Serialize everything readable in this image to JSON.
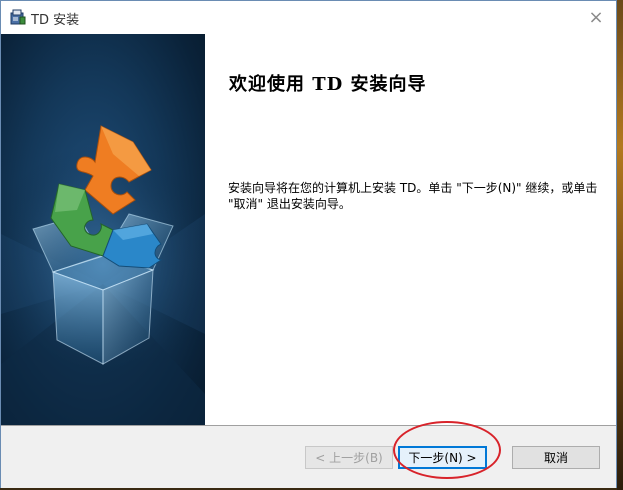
{
  "window": {
    "title": "TD 安装",
    "close_glyph": "×"
  },
  "welcome": {
    "heading": "欢迎使用 TD 安装向导",
    "description": "安装向导将在您的计算机上安装 TD。单击 \"下一步(N)\" 继续，或单击 \"取消\" 退出安装向导。"
  },
  "buttons": {
    "back_label": "< 上一步(B)",
    "next_label": "下一步(N) >",
    "cancel_label": "取消"
  },
  "icons": {
    "title": "installer-package-icon",
    "banner": "puzzle-box-icon"
  },
  "colors": {
    "accent": "#0078d7",
    "annotation": "#d8232a",
    "banner": "#133758"
  }
}
